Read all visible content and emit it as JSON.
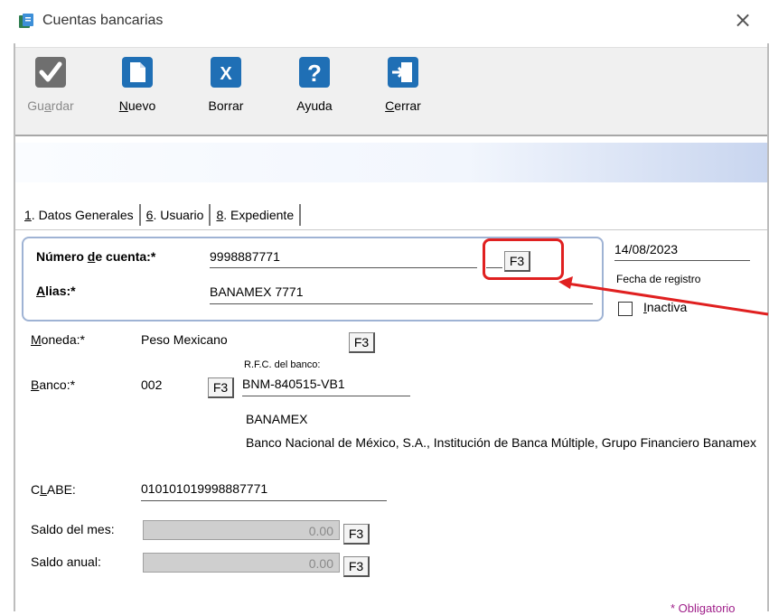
{
  "window": {
    "title": "Cuentas bancarias",
    "close_glyph": "×"
  },
  "toolbar": {
    "buttons": [
      {
        "key": "guardar",
        "label": "Guardar",
        "underline": "a",
        "icon": "check-icon",
        "enabled": false
      },
      {
        "key": "nuevo",
        "label": "Nuevo",
        "underline": "N",
        "icon": "new-document-icon",
        "enabled": true
      },
      {
        "key": "borrar",
        "label": "Borrar",
        "icon": "delete-x-icon",
        "enabled": true
      },
      {
        "key": "ayuda",
        "label": "Ayuda",
        "icon": "help-question-icon",
        "enabled": true
      },
      {
        "key": "cerrar",
        "label": "Cerrar",
        "underline": "C",
        "icon": "exit-door-icon",
        "enabled": true
      }
    ]
  },
  "tabs": [
    {
      "label": "1. Datos Generales",
      "active": true
    },
    {
      "label": "6. Usuario",
      "active": false
    },
    {
      "label": "8. Expediente",
      "active": false
    }
  ],
  "form": {
    "numero_cuenta_label": "Número de cuenta:*",
    "numero_cuenta_value": "9998887771",
    "alias_label": "Alias:*",
    "alias_value": "BANAMEX 7771",
    "fecha_value": "14/08/2023",
    "fecha_label": "Fecha de registro",
    "inactiva_label": "Inactiva",
    "moneda_label": "Moneda:*",
    "moneda_value": "Peso Mexicano",
    "banco_label": "Banco:*",
    "banco_value": "002",
    "rfc_label": "R.F.C. del banco:",
    "rfc_value": "BNM-840515-VB1",
    "bank_short_name": "BANAMEX",
    "bank_full_name": "Banco Nacional de México, S.A., Institución de Banca Múltiple, Grupo Financiero Banamex",
    "clabe_label": "CLABE:",
    "clabe_value": "010101019998887771",
    "saldo_mes_label": "Saldo del mes:",
    "saldo_mes_value": "0.00",
    "saldo_anual_label": "Saldo anual:",
    "saldo_anual_value": "0.00",
    "f3_label": "F3",
    "obligatorio_label": "* Obligatorio"
  },
  "colors": {
    "accent": "#1f6fb5",
    "annotation": "#e02020",
    "required_note": "#a0208a"
  }
}
